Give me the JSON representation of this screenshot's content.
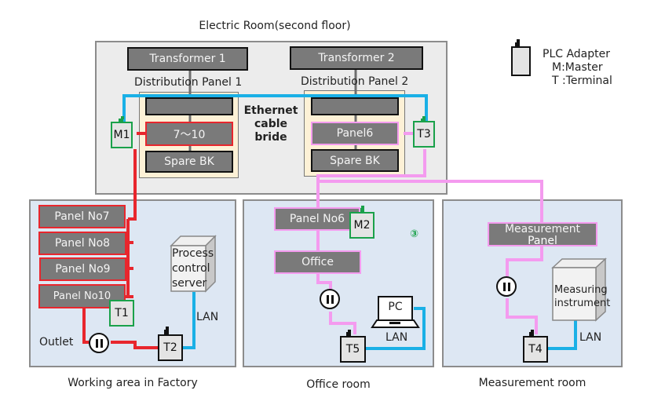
{
  "title": "Electric Room(second floor)",
  "legend": {
    "icon": "plc-adapter-icon",
    "lines": [
      "PLC Adapter",
      "M:Master",
      "T :Terminal"
    ]
  },
  "electric_room": {
    "transformer1": "Transformer 1",
    "transformer2": "Transformer  2",
    "dist_panel1": "Distribution Panel 1",
    "dist_panel2": "Distribution Panel 2",
    "panel1_breaker": "7～10",
    "panel1_spare": "Spare  BK",
    "panel2_breaker": "Panel6",
    "panel2_spare": "Spare BK",
    "ethernet_note": [
      "Ethernet",
      "cable",
      "bride"
    ],
    "adapter_m1": "M1",
    "adapter_t3": "T3"
  },
  "factory": {
    "caption": "Working area in Factory",
    "panels": [
      "Panel No7",
      "Panel No8",
      "Panel No9",
      "Panel No10"
    ],
    "server": [
      "Process",
      "control",
      "server"
    ],
    "lan": "LAN",
    "outlet": "Outlet",
    "adapter_t1": "T1",
    "adapter_t2": "T2"
  },
  "office": {
    "caption": "Office room",
    "panel": "Panel No6",
    "office_box": "Office",
    "marker": "③",
    "pc": "PC",
    "lan": "LAN",
    "adapter_m2": "M2",
    "adapter_t5": "T5"
  },
  "measurement": {
    "caption": "Measurement room",
    "panel": [
      "Measurement",
      "Panel"
    ],
    "instrument": [
      "Measuring",
      "instrument"
    ],
    "lan": "LAN",
    "adapter_t4": "T4"
  },
  "colors": {
    "master_red": "#e8262d",
    "branch_pink": "#f49bef",
    "lan_blue": "#1ab0e6",
    "adapter_green": "#1aa14a"
  }
}
